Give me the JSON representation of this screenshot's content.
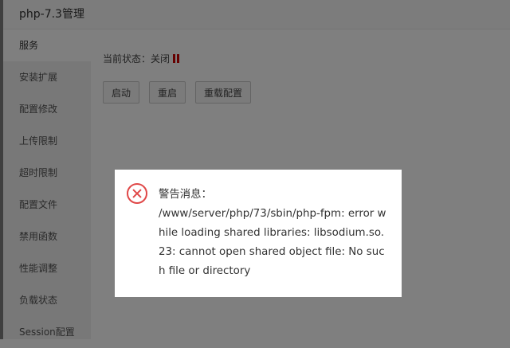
{
  "window": {
    "title": "php-7.3管理"
  },
  "sidebar": {
    "items": [
      {
        "label": "服务",
        "active": true
      },
      {
        "label": "安装扩展"
      },
      {
        "label": "配置修改"
      },
      {
        "label": "上传限制"
      },
      {
        "label": "超时限制"
      },
      {
        "label": "配置文件"
      },
      {
        "label": "禁用函数"
      },
      {
        "label": "性能调整"
      },
      {
        "label": "负载状态"
      },
      {
        "label": "Session配置"
      }
    ]
  },
  "service": {
    "status_label": "当前状态：",
    "status_value": "关闭",
    "status_color": "#cc0000",
    "buttons": {
      "start": "启动",
      "restart": "重启",
      "reload": "重载配置"
    }
  },
  "dialog": {
    "icon": "error-circle-icon",
    "title": "警告消息：",
    "message": "/www/server/php/73/sbin/php-fpm: error while loading shared libraries: libsodium.so.23: cannot open shared object file: No such file or directory"
  }
}
